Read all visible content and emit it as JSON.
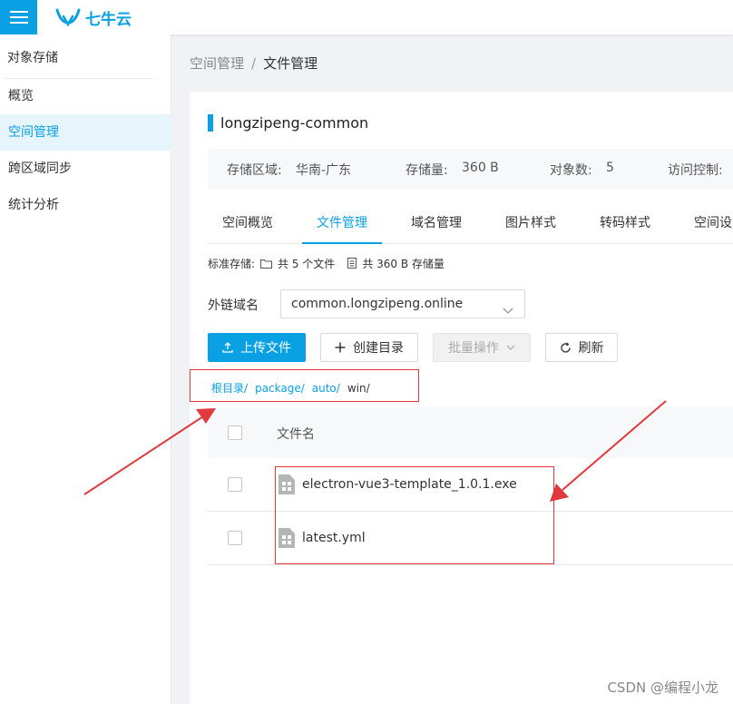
{
  "brand": {
    "logo_text": "七牛云"
  },
  "sidebar": {
    "heading": "对象存储",
    "items": [
      {
        "label": "概览"
      },
      {
        "label": "空间管理"
      },
      {
        "label": "跨区域同步"
      },
      {
        "label": "统计分析"
      }
    ]
  },
  "breadcrumb": {
    "parent": "空间管理",
    "separator": "/",
    "current": "文件管理"
  },
  "bucket": {
    "name": "longzipeng-common",
    "region_label": "存储区域:",
    "region_value": "华南-广东",
    "size_label": "存储量:",
    "size_value": "360 B",
    "objects_label": "对象数:",
    "objects_value": "5",
    "access_label": "访问控制:"
  },
  "tabs": [
    {
      "label": "空间概览"
    },
    {
      "label": "文件管理"
    },
    {
      "label": "域名管理"
    },
    {
      "label": "图片样式"
    },
    {
      "label": "转码样式"
    },
    {
      "label": "空间设"
    }
  ],
  "stats": {
    "storage_type": "标准存储:",
    "file_count": "共 5 个文件",
    "total_size": "共 360 B 存储量"
  },
  "domain": {
    "label": "外链域名",
    "value": "common.longzipeng.online"
  },
  "toolbar": {
    "upload": "上传文件",
    "mkdir": "创建目录",
    "batch": "批量操作",
    "refresh": "刷新"
  },
  "path": {
    "segments": [
      "根目录/",
      "package/",
      "auto/"
    ],
    "current": "win/"
  },
  "table": {
    "header": "文件名",
    "rows": [
      {
        "name": "electron-vue3-template_1.0.1.exe"
      },
      {
        "name": "latest.yml"
      }
    ]
  },
  "watermark": "CSDN @编程小龙",
  "colors": {
    "accent": "#0aa0e4",
    "annotation": "#e0393e"
  }
}
